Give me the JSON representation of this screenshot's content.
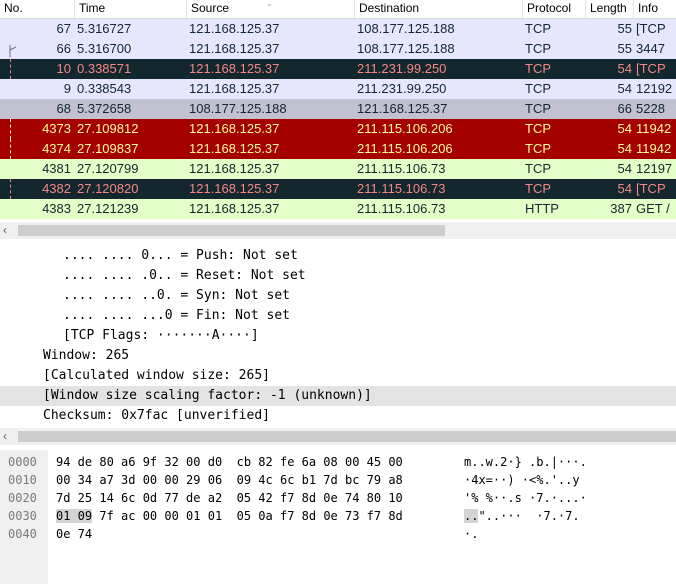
{
  "packet_list": {
    "columns": {
      "no": "No.",
      "time": "Time",
      "source": "Source",
      "destination": "Destination",
      "protocol": "Protocol",
      "length": "Length",
      "info": "Info"
    },
    "rows": [
      {
        "no": "67",
        "time": "5.316727",
        "source": "121.168.125.37",
        "destination": "108.177.125.188",
        "protocol": "TCP",
        "length": "55",
        "info": "[TCP",
        "bg": "#e7e6ff",
        "fg": "#12272e"
      },
      {
        "no": "66",
        "time": "5.316700",
        "source": "121.168.125.37",
        "destination": "108.177.125.188",
        "protocol": "TCP",
        "length": "55",
        "info": "3447",
        "bg": "#e7e6ff",
        "fg": "#12272e"
      },
      {
        "no": "10",
        "time": "0.338571",
        "source": "121.168.125.37",
        "destination": "211.231.99.250",
        "protocol": "TCP",
        "length": "54",
        "info": "[TCP",
        "bg": "#12272e",
        "fg": "#f78787"
      },
      {
        "no": "9",
        "time": "0.338543",
        "source": "121.168.125.37",
        "destination": "211.231.99.250",
        "protocol": "TCP",
        "length": "54",
        "info": "12192",
        "bg": "#e7e6ff",
        "fg": "#12272e"
      },
      {
        "no": "68",
        "time": "5.372658",
        "source": "108.177.125.188",
        "destination": "121.168.125.37",
        "protocol": "TCP",
        "length": "66",
        "info": "5228",
        "bg": "#c1c1d2",
        "fg": "#12272e"
      },
      {
        "no": "4373",
        "time": "27.109812",
        "source": "121.168.125.37",
        "destination": "211.115.106.206",
        "protocol": "TCP",
        "length": "54",
        "info": "11942",
        "bg": "#a40000",
        "fg": "#fffc9c"
      },
      {
        "no": "4374",
        "time": "27.109837",
        "source": "121.168.125.37",
        "destination": "211.115.106.206",
        "protocol": "TCP",
        "length": "54",
        "info": "11942",
        "bg": "#a40000",
        "fg": "#fffc9c"
      },
      {
        "no": "4381",
        "time": "27.120799",
        "source": "121.168.125.37",
        "destination": "211.115.106.73",
        "protocol": "TCP",
        "length": "54",
        "info": "12197",
        "bg": "#e4ffc7",
        "fg": "#12272e"
      },
      {
        "no": "4382",
        "time": "27.120820",
        "source": "121.168.125.37",
        "destination": "211.115.106.73",
        "protocol": "TCP",
        "length": "54",
        "info": "[TCP",
        "bg": "#12272e",
        "fg": "#f78787"
      },
      {
        "no": "4383",
        "time": "27.121239",
        "source": "121.168.125.37",
        "destination": "211.115.106.73",
        "protocol": "HTTP",
        "length": "387",
        "info": "GET /",
        "bg": "#e4ffc7",
        "fg": "#12272e"
      }
    ]
  },
  "details": {
    "lines": [
      {
        "text": ".... .... 0... = Push: Not set",
        "indent": "deep",
        "selected": false
      },
      {
        "text": ".... .... .0.. = Reset: Not set",
        "indent": "deep",
        "selected": false
      },
      {
        "text": ".... .... ..0. = Syn: Not set",
        "indent": "deep",
        "selected": false
      },
      {
        "text": ".... .... ...0 = Fin: Not set",
        "indent": "deep",
        "selected": false
      },
      {
        "text": "[TCP Flags: ·······A····]",
        "indent": "deep",
        "selected": false
      },
      {
        "text": "Window: 265",
        "indent": "shallow",
        "selected": false
      },
      {
        "text": "[Calculated window size: 265]",
        "indent": "shallow",
        "selected": false
      },
      {
        "text": "[Window size scaling factor: -1 (unknown)]",
        "indent": "shallow",
        "selected": true
      },
      {
        "text": "Checksum: 0x7fac [unverified]",
        "indent": "shallow",
        "selected": false
      }
    ]
  },
  "bytes": {
    "lines": [
      {
        "offset": "0000",
        "hex": "94 de 80 a6 9f 32 00 d0  cb 82 fe 6a 08 00 45 00",
        "hex_hl": "",
        "hex_tail": "",
        "ascii": "m..w.2·} .b.|···."
      },
      {
        "offset": "0010",
        "hex": "00 34 a7 3d 00 00 29 06  09 4c 6c b1 7d bc 79 a8",
        "hex_hl": "",
        "hex_tail": "",
        "ascii": "·4x=··) ·<%.'..y"
      },
      {
        "offset": "0020",
        "hex": "7d 25 14 6c 0d 77 de a2  05 42 f7 8d 0e 74 80 10",
        "hex_hl": "",
        "hex_tail": "",
        "ascii": "'% %··.s ·7.·...·"
      },
      {
        "offset": "0030",
        "hex": "",
        "hex_hl": "01 09",
        "hex_tail": " 7f ac 00 00 01 01  05 0a f7 8d 0e 73 f7 8d",
        "ascii_hl": "..",
        "ascii": "\"..···  ·7.·7."
      },
      {
        "offset": "0040",
        "hex": "0e 74",
        "hex_hl": "",
        "hex_tail": "",
        "ascii": "·."
      }
    ]
  }
}
